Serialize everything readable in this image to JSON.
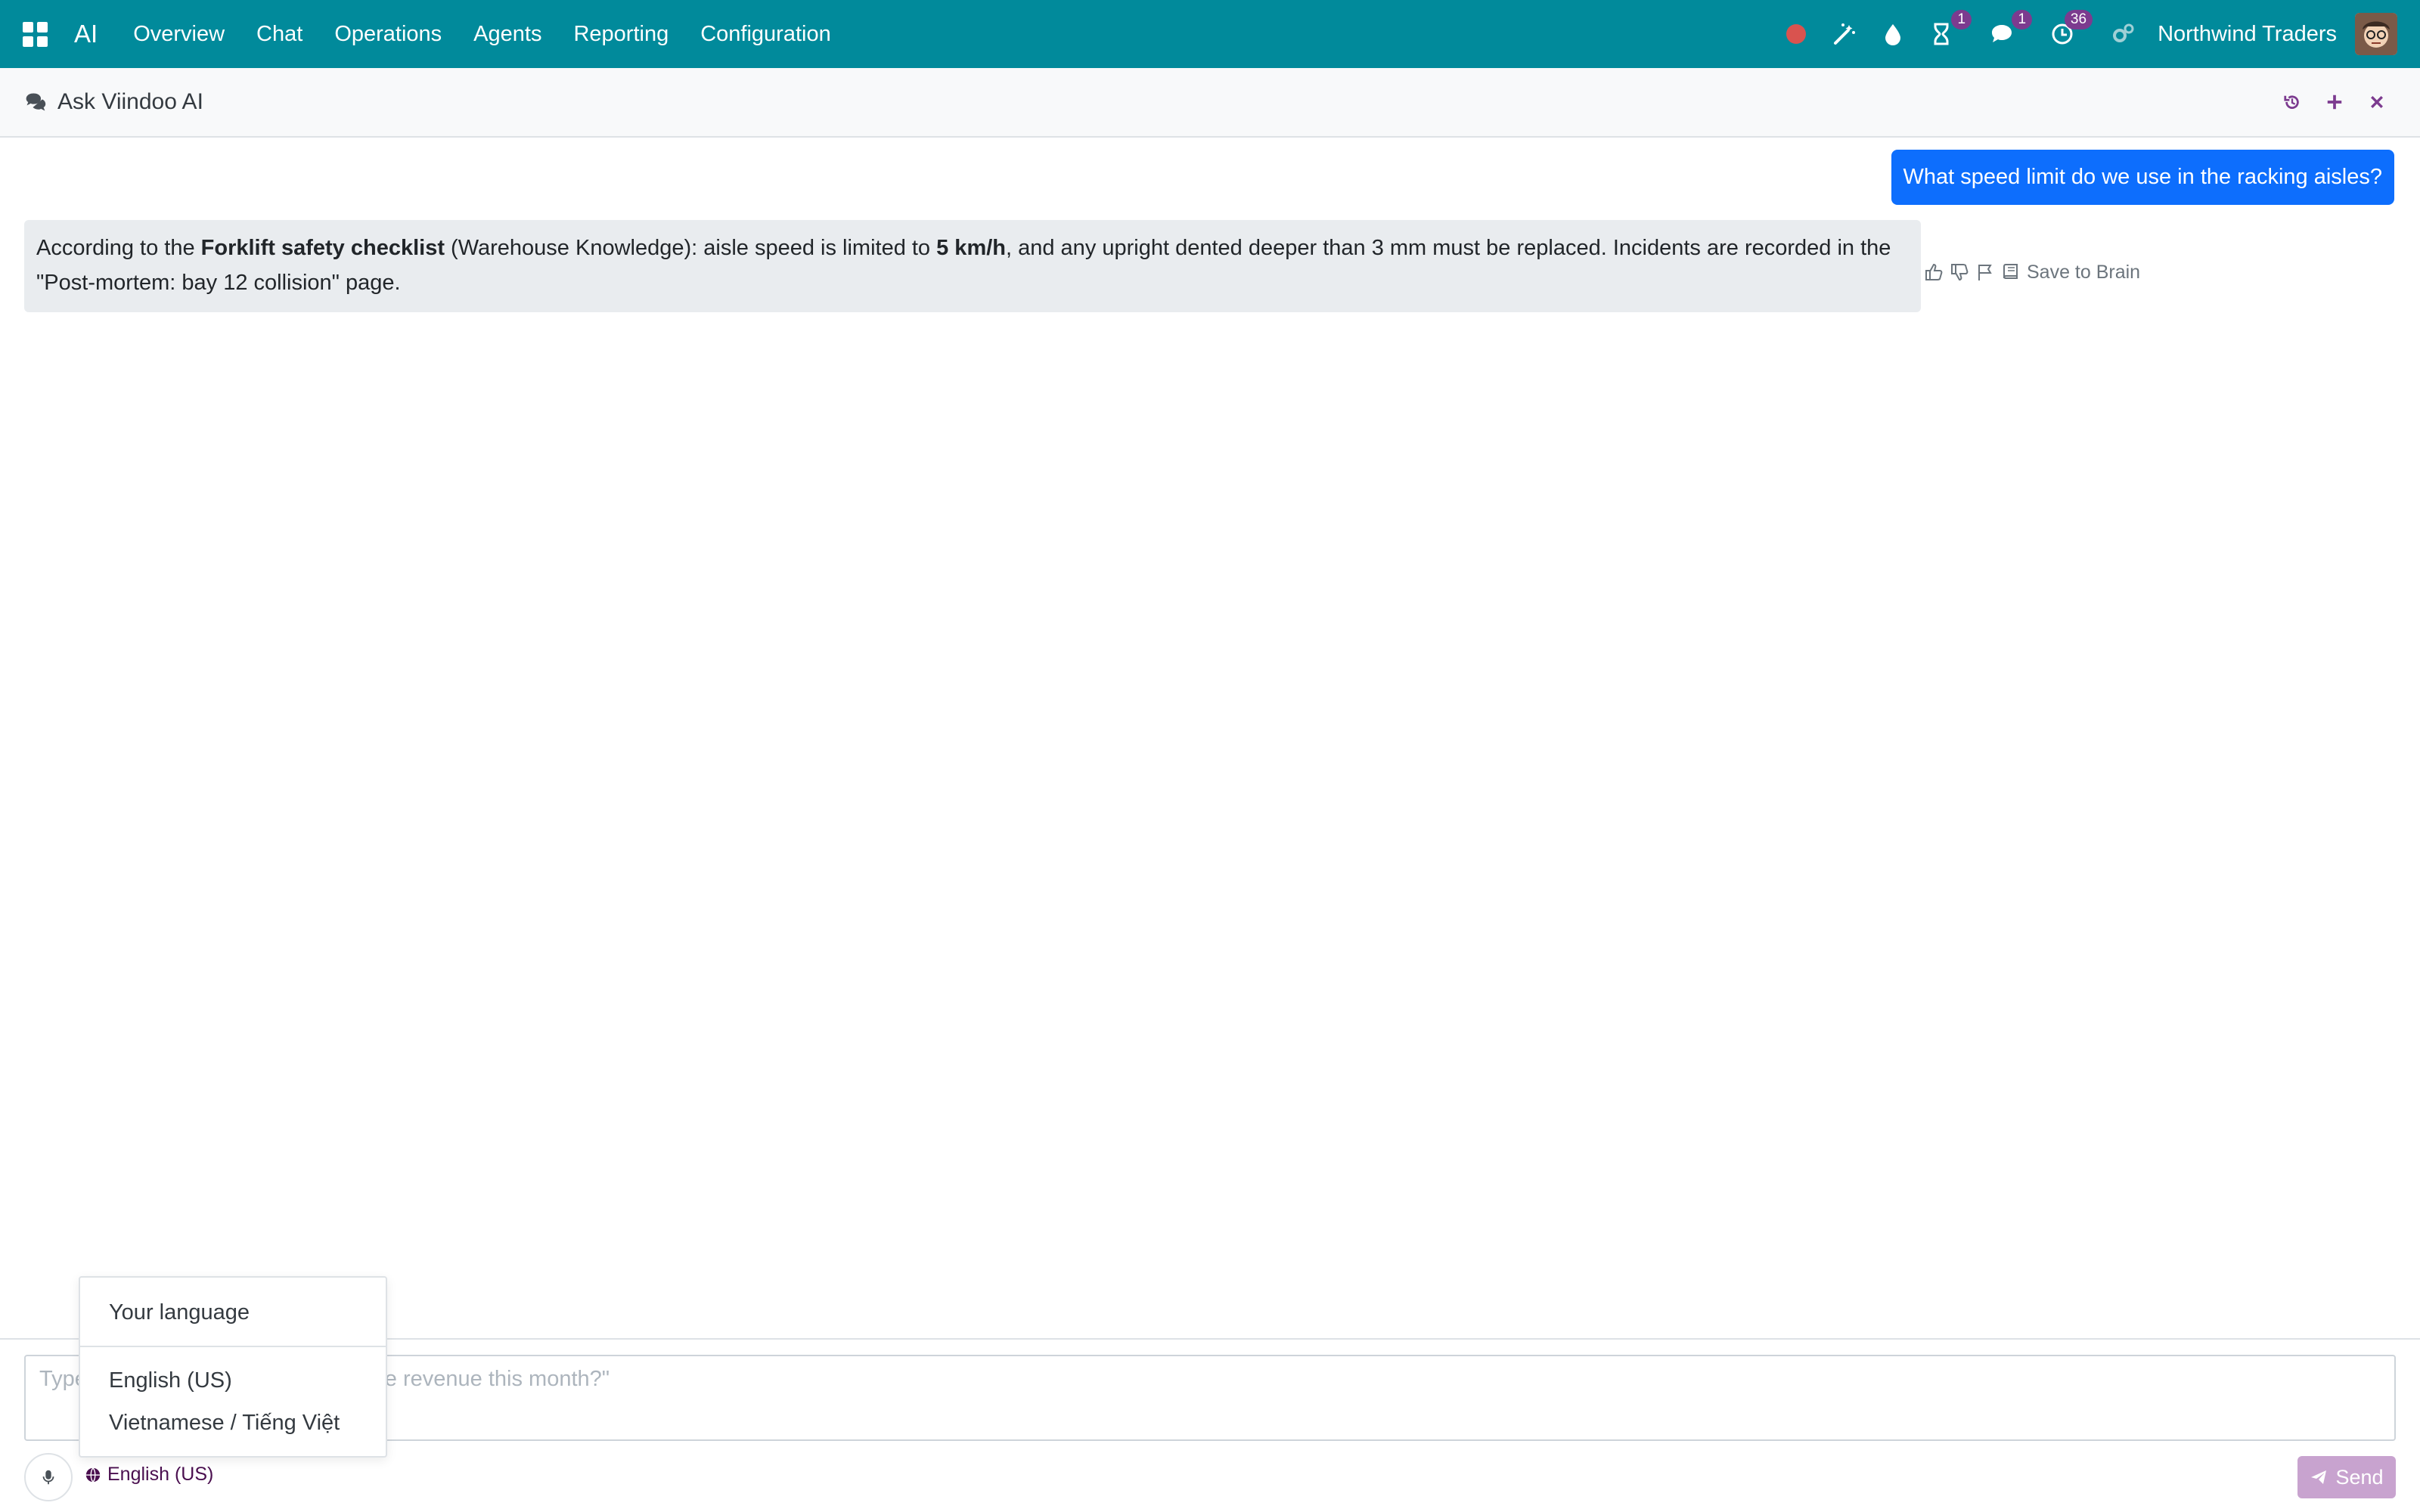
{
  "navbar": {
    "app_name": "AI",
    "menu": [
      "Overview",
      "Chat",
      "Operations",
      "Agents",
      "Reporting",
      "Configuration"
    ],
    "systray": {
      "activity_badge": "1",
      "messages_badge": "1",
      "timer_badge": "36",
      "company": "Northwind Traders"
    }
  },
  "chat": {
    "title": "Ask Viindoo AI",
    "user_message": "What speed limit do we use in the racking aisles?",
    "ai_message": {
      "part1": "According to the ",
      "bold1": "Forklift safety checklist",
      "part2": " (Warehouse Knowledge): aisle speed is limited to ",
      "bold2": "5 km/h",
      "part3": ", and any upright dented deeper than 3 mm must be replaced. Incidents are recorded in the \"Post-mortem: bay 12 collision\" page."
    },
    "save_to_brain": "Save to Brain"
  },
  "composer": {
    "placeholder": "Type your question, e.g. \"What is the revenue this month?\"",
    "language": "English (US)",
    "send_label": "Send"
  },
  "language_dropdown": {
    "header": "Your language",
    "options": [
      "English (US)",
      "Vietnamese / Tiếng Việt"
    ]
  },
  "colors": {
    "navbar": "#018a9b",
    "user_bubble": "#0d6efd",
    "ai_bubble": "#e9ecef",
    "badge": "#7c3b8f",
    "send_button": "#c8a3cf",
    "accent": "#4a0f4f"
  }
}
